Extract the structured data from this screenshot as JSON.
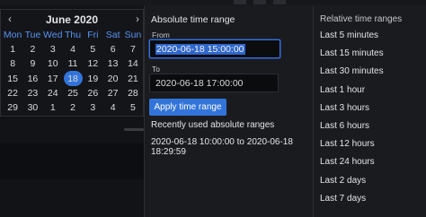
{
  "calendar": {
    "title": "June 2020",
    "prev_icon": "‹",
    "next_icon": "›",
    "weekdays": [
      "Mon",
      "Tue",
      "Wed",
      "Thu",
      "Fri",
      "Sat",
      "Sun"
    ],
    "weeks": [
      [
        "1",
        "2",
        "3",
        "4",
        "5",
        "6",
        "7"
      ],
      [
        "8",
        "9",
        "10",
        "11",
        "12",
        "13",
        "14"
      ],
      [
        "15",
        "16",
        "17",
        "18",
        "19",
        "20",
        "21"
      ],
      [
        "22",
        "23",
        "24",
        "25",
        "26",
        "27",
        "28"
      ],
      [
        "29",
        "30",
        "1",
        "2",
        "3",
        "4",
        "5"
      ]
    ],
    "selected_day": "18"
  },
  "absolute": {
    "title": "Absolute time range",
    "from_label": "From",
    "from_value": "2020-06-18 15:00:00",
    "to_label": "To",
    "to_value": "2020-06-18 17:00:00",
    "apply_label": "Apply time range",
    "recent_title": "Recently used absolute ranges",
    "recent_items": [
      "2020-06-18 10:00:00 to 2020-06-18 18:29:59"
    ]
  },
  "relative": {
    "title": "Relative time ranges",
    "items": [
      "Last 5 minutes",
      "Last 15 minutes",
      "Last 30 minutes",
      "Last 1 hour",
      "Last 3 hours",
      "Last 6 hours",
      "Last 12 hours",
      "Last 24 hours",
      "Last 2 days",
      "Last 7 days"
    ]
  },
  "colors": {
    "accent": "#3274d9",
    "weekday_header": "#5794f2",
    "panel_bg": "#1a1b1f",
    "input_bg": "#0b0c0e"
  }
}
